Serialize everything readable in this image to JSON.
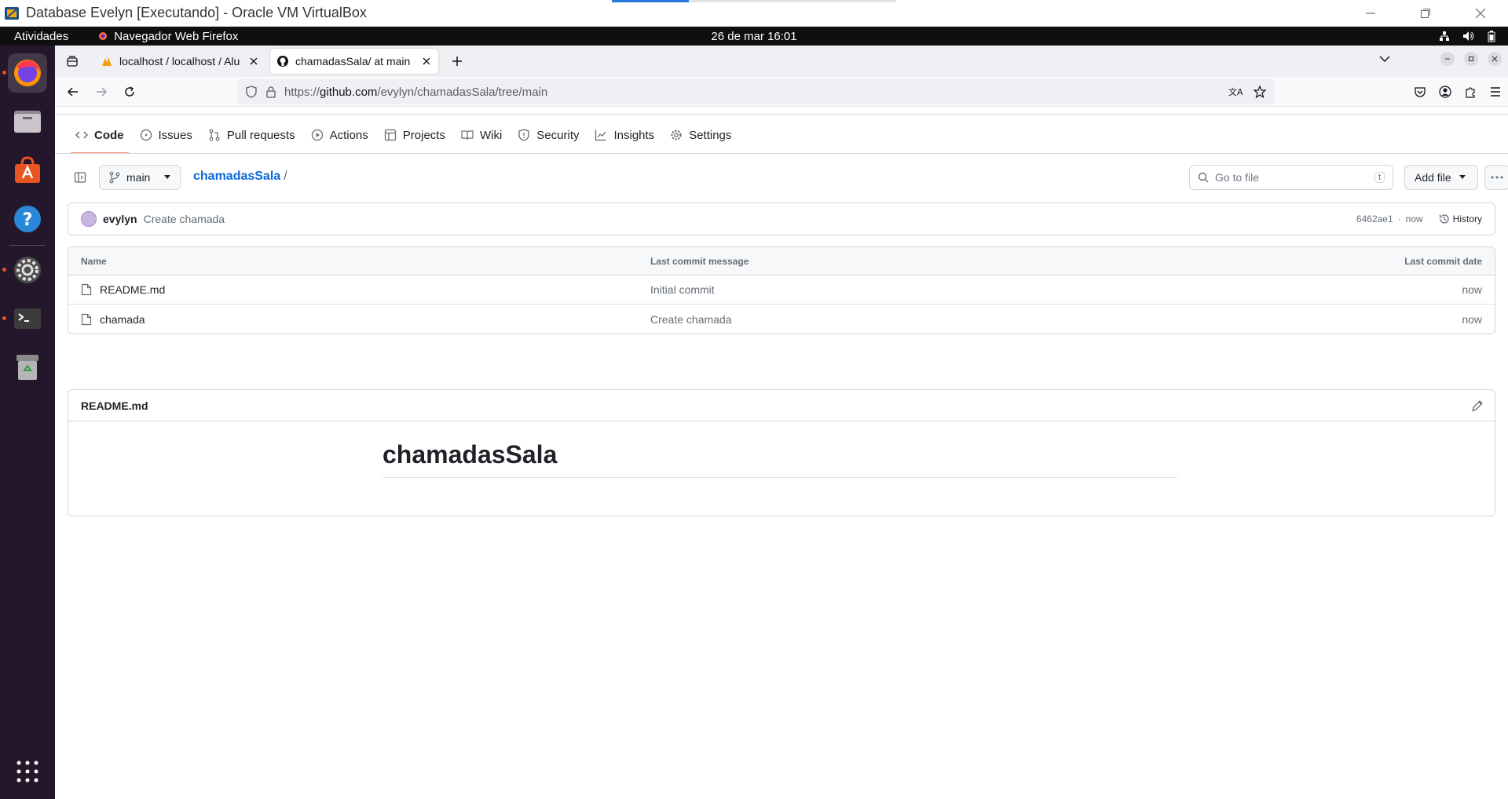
{
  "host_window": {
    "title": "Database Evelyn [Executando] - Oracle VM VirtualBox",
    "progress": 0.27
  },
  "gnome": {
    "activities": "Atividades",
    "app_name": "Navegador Web Firefox",
    "clock": "26 de mar  16:01"
  },
  "dock": {
    "apps": [
      "firefox-icon",
      "files-icon",
      "app-center-icon",
      "help-icon",
      "settings-icon",
      "terminal-icon",
      "trash-icon",
      "show-apps-icon"
    ]
  },
  "browser": {
    "tabs": [
      {
        "title": "localhost / localhost / Alu",
        "active": false
      },
      {
        "title": "chamadasSala/ at main · e",
        "active": true
      }
    ],
    "url_prefix": "https://",
    "url_host": "github.com",
    "url_path": "/evylyn/chamadasSala/tree/main"
  },
  "repo_nav": {
    "items": [
      {
        "label": "Code",
        "icon": "code-icon",
        "active": true
      },
      {
        "label": "Issues",
        "icon": "issue-icon"
      },
      {
        "label": "Pull requests",
        "icon": "pull-request-icon"
      },
      {
        "label": "Actions",
        "icon": "play-icon"
      },
      {
        "label": "Projects",
        "icon": "table-icon"
      },
      {
        "label": "Wiki",
        "icon": "book-icon"
      },
      {
        "label": "Security",
        "icon": "shield-icon"
      },
      {
        "label": "Insights",
        "icon": "graph-icon"
      },
      {
        "label": "Settings",
        "icon": "gear-icon"
      }
    ]
  },
  "file_header": {
    "branch": "main",
    "repo": "chamadasSala",
    "crumb_sep": "/",
    "goto_placeholder": "Go to file",
    "goto_kbd": "t",
    "add_file": "Add file"
  },
  "commit": {
    "author": "evylyn",
    "message": "Create chamada",
    "sha": "6462ae1",
    "sep": "·",
    "time": "now",
    "history": "History"
  },
  "files": {
    "headers": {
      "name": "Name",
      "message": "Last commit message",
      "date": "Last commit date"
    },
    "rows": [
      {
        "name": "README.md",
        "message": "Initial commit",
        "date": "now"
      },
      {
        "name": "chamada",
        "message": "Create chamada",
        "date": "now"
      }
    ]
  },
  "readme": {
    "filename": "README.md",
    "heading": "chamadasSala"
  },
  "colors": {
    "accent_link": "#0969da",
    "tab_underline": "#fd8c73",
    "dock_bg": "#25172b",
    "ubuntu_orange": "#e95420"
  }
}
